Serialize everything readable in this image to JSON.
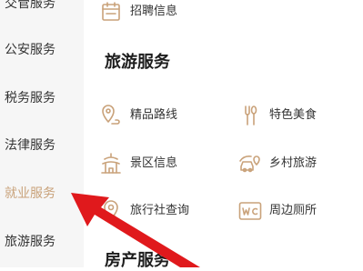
{
  "sidebar": {
    "items": [
      {
        "label": "交管服务"
      },
      {
        "label": "公安服务"
      },
      {
        "label": "税务服务"
      },
      {
        "label": "法律服务"
      },
      {
        "label": "就业服务",
        "active": true
      },
      {
        "label": "旅游服务"
      }
    ]
  },
  "main": {
    "prev_item": {
      "label": "招聘信息",
      "icon": "calendar-icon"
    },
    "sections": [
      {
        "title": "旅游服务",
        "items": [
          {
            "label": "精品路线",
            "icon": "route-pin-icon"
          },
          {
            "label": "特色美食",
            "icon": "fork-spoon-icon"
          },
          {
            "label": "景区信息",
            "icon": "pagoda-icon"
          },
          {
            "label": "乡村旅游",
            "icon": "car-pin-icon"
          },
          {
            "label": "旅行社查询",
            "icon": "location-pin-icon"
          },
          {
            "label": "周边厕所",
            "icon": "wc-icon"
          }
        ]
      },
      {
        "title": "房产服务"
      }
    ]
  },
  "colors": {
    "accent": "#c9a27a",
    "arrow": "#e0191c",
    "sidebar_bg": "#f6f6f6"
  }
}
